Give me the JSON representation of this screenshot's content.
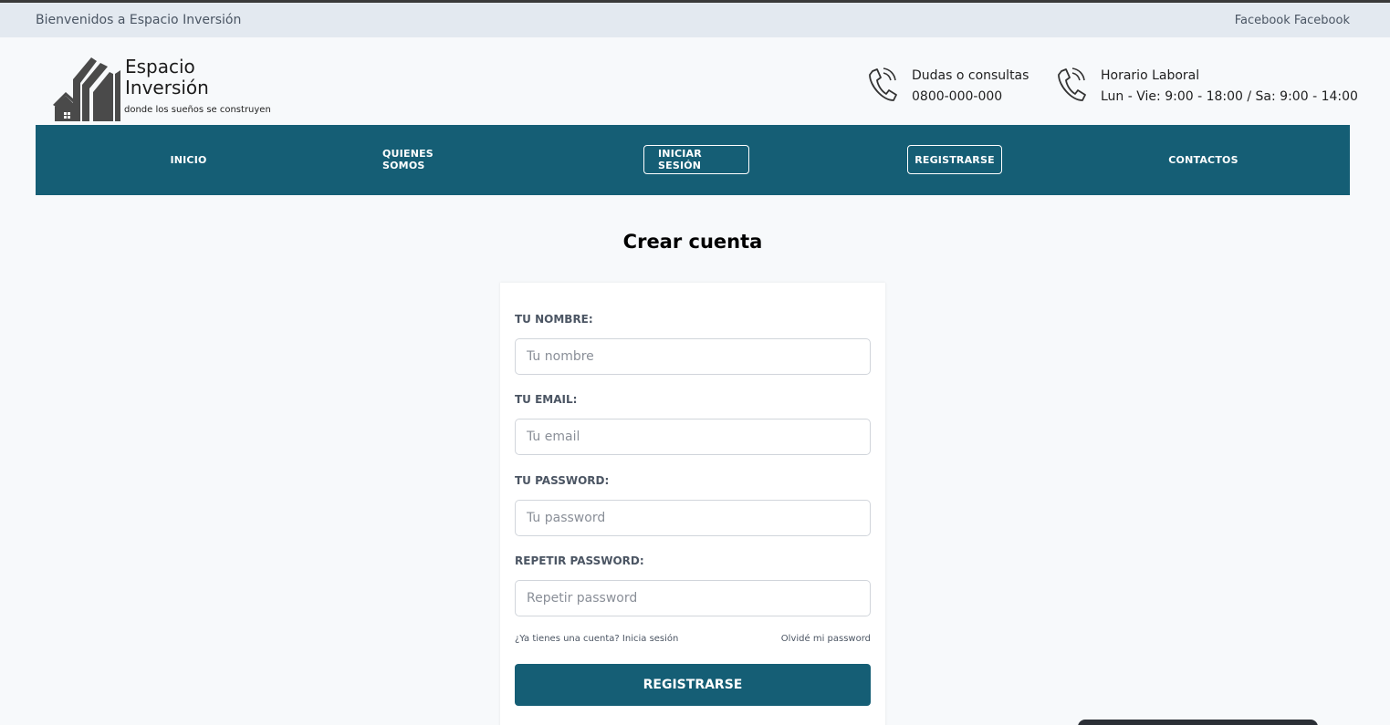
{
  "topbar": {
    "welcome": "Bienvenidos a Espacio Inversión",
    "social": "Facebook Facebook"
  },
  "logo": {
    "line1": "Espacio",
    "line2": "Inversión",
    "tagline": "donde los sueños se construyen"
  },
  "contacts": [
    {
      "icon": "phone-icon",
      "title": "Dudas o consultas",
      "detail": "0800-000-000"
    },
    {
      "icon": "phone-icon",
      "title": "Horario Laboral",
      "detail": "Lun - Vie: 9:00 - 18:00 / Sa: 9:00 - 14:00"
    }
  ],
  "nav": {
    "items": [
      {
        "label": "INICIO"
      },
      {
        "label": "QUIENES SOMOS"
      },
      {
        "label": "INICIAR SESIÓN"
      },
      {
        "label": "REGISTRARSE"
      },
      {
        "label": "CONTACTOS"
      }
    ]
  },
  "page": {
    "title": "Crear cuenta"
  },
  "form": {
    "name_label": "TU NOMBRE:",
    "name_placeholder": "Tu nombre",
    "email_label": "TU EMAIL:",
    "email_placeholder": "Tu email",
    "password_label": "TU PASSWORD:",
    "password_placeholder": "Tu password",
    "repeat_label": "REPETIR PASSWORD:",
    "repeat_placeholder": "Repetir password",
    "login_link": "¿Ya tienes una cuenta? Inicia sesión",
    "forgot_link": "Olvidé mi password",
    "submit": "REGISTRARSE"
  },
  "colors": {
    "primary": "#155e75",
    "topbar_bg": "#e3e9f0",
    "page_bg": "#f7f9fb"
  }
}
